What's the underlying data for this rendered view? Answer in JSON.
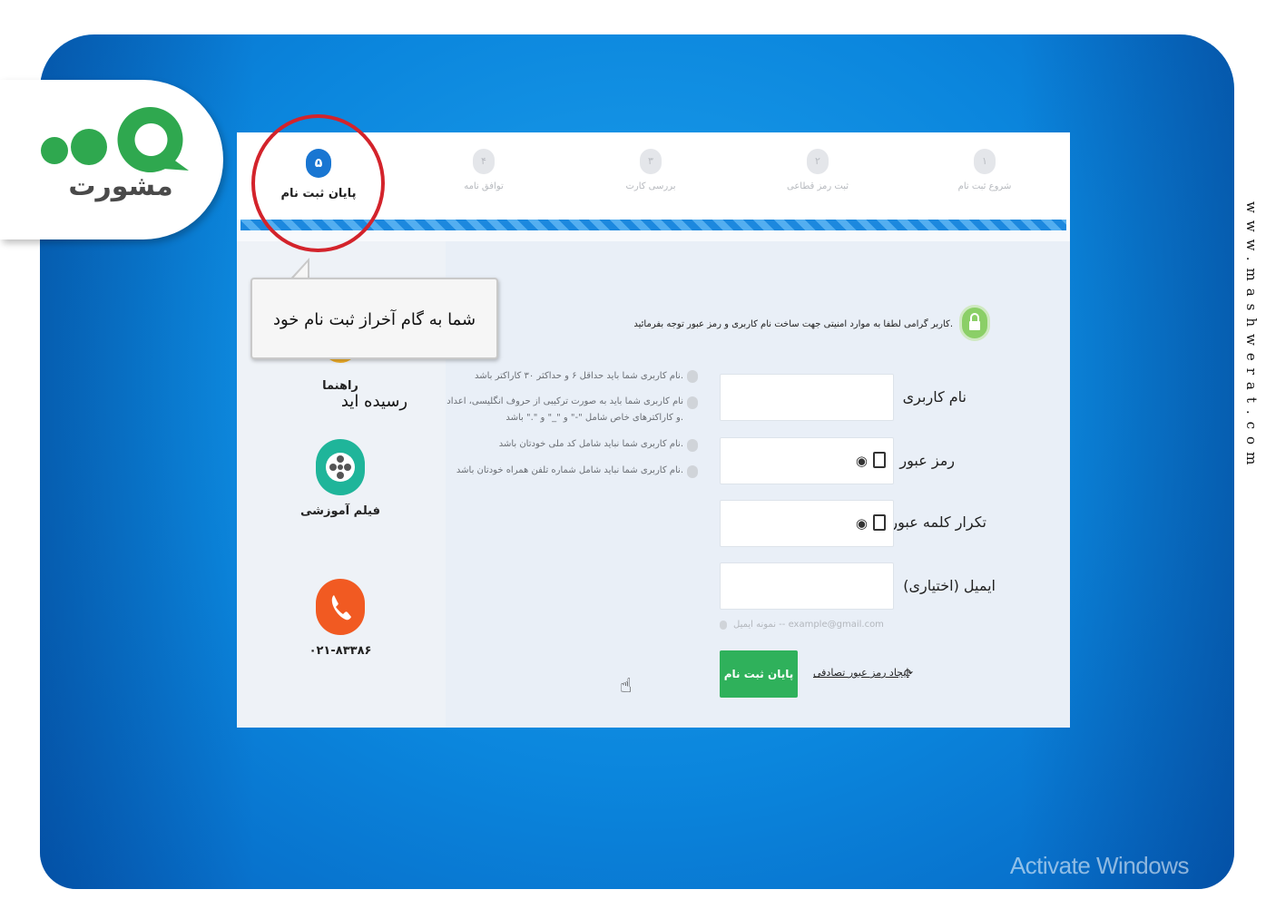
{
  "logo": {
    "text": "مشورت"
  },
  "watermark": {
    "side_url": "www.mashwerat.com",
    "activate": "Activate Windows"
  },
  "steps": [
    {
      "number": "۵",
      "label": "پایان ثبت نام",
      "active": true
    },
    {
      "number": "۴",
      "label": "توافق نامه",
      "active": false
    },
    {
      "number": "۳",
      "label": "بررسی کارت",
      "active": false
    },
    {
      "number": "۲",
      "label": "ثبت رمز قطاعی",
      "active": false
    },
    {
      "number": "۱",
      "label": "شروع ثبت نام",
      "active": false
    }
  ],
  "tooltip": {
    "text": "شما به گام آخراز ثبت نام خود رسیده اید"
  },
  "sidebar": {
    "guide_label": "راهنما",
    "film_label": "فیلم آموزشی",
    "phone_label": "۰۲۱-۸۳۳۸۶"
  },
  "form": {
    "notice": "کاربر گرامی لطفا به موارد امنیتی جهت ساخت نام کاربری و رمز عبور توجه بفرمائید.",
    "username_label": "نام کاربری",
    "password_label": "رمز عبور",
    "repeat_password_label": "تکرار کلمه عبور",
    "email_label": "ایمیل (اختیاری)",
    "email_hint": "نمونه ایمیل -- example@gmail.com",
    "submit_label": "پایان ثبت نام",
    "generate_link": "ایجاد رمز عبور تصادفی",
    "rules": [
      "نام کاربری شما باید حداقل ۶ و حداکثر ۳۰ کاراکتر باشد.",
      "نام کاربری شما باید به صورت ترکیبی از حروف انگلیسی، اعداد",
      "و کاراکترهای خاص شامل \"-\" و \"_\" و \".\" باشد.",
      "نام کاربری شما نباید شامل کد ملی خودتان باشد.",
      "نام کاربری شما نباید شامل شماره تلفن همراه خودتان باشد."
    ]
  }
}
